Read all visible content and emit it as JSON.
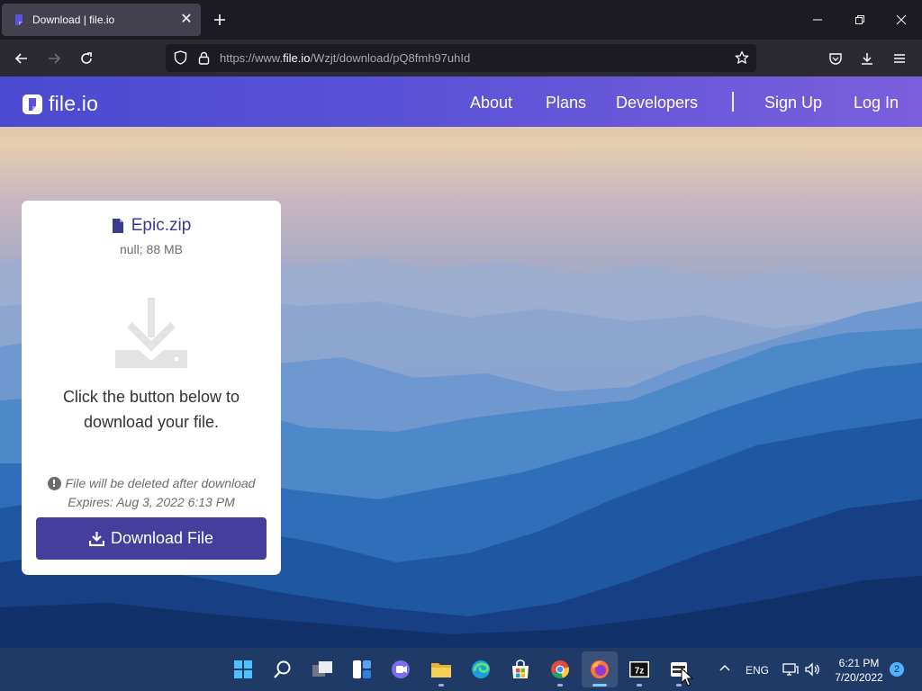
{
  "browser": {
    "tab": {
      "title": "Download | file.io",
      "favicon": "fileio-favicon",
      "close_icon": "close-icon"
    },
    "new_tab_icon": "plus-icon",
    "window_controls": [
      "minimize-icon",
      "restore-icon",
      "close-icon"
    ],
    "nav_icons": [
      "back-arrow-icon",
      "forward-arrow-icon",
      "reload-icon"
    ],
    "url": {
      "prefix": "https://www.",
      "domain": "file.io",
      "path": "/Wzjt/download/pQ8fmh97uhId"
    },
    "url_icons": [
      "shield-icon",
      "lock-icon",
      "star-icon"
    ],
    "toolbar_icons": [
      "pocket-icon",
      "downloads-icon",
      "menu-icon"
    ]
  },
  "site": {
    "logo_text": "file.io",
    "nav": [
      "About",
      "Plans",
      "Developers",
      "Sign Up",
      "Log In"
    ],
    "brand_color": "#463e9c"
  },
  "card": {
    "file_name": "Epic.zip",
    "file_meta": "null; 88 MB",
    "instruction": "Click the button below to download your file.",
    "warning": "File will be deleted after download",
    "expires": "Expires: Aug 3, 2022 6:13 PM",
    "button_label": "Download File"
  },
  "taskbar": {
    "apps": [
      "windows-start-icon",
      "search-icon",
      "task-view-icon",
      "widgets-icon",
      "teams-chat-icon",
      "file-explorer-icon",
      "edge-icon",
      "store-icon",
      "chrome-icon",
      "firefox-icon",
      "7zip-icon",
      "app-icon"
    ],
    "tray": {
      "language": "ENG",
      "time": "6:21 PM",
      "date": "7/20/2022",
      "notifications": "2"
    }
  }
}
